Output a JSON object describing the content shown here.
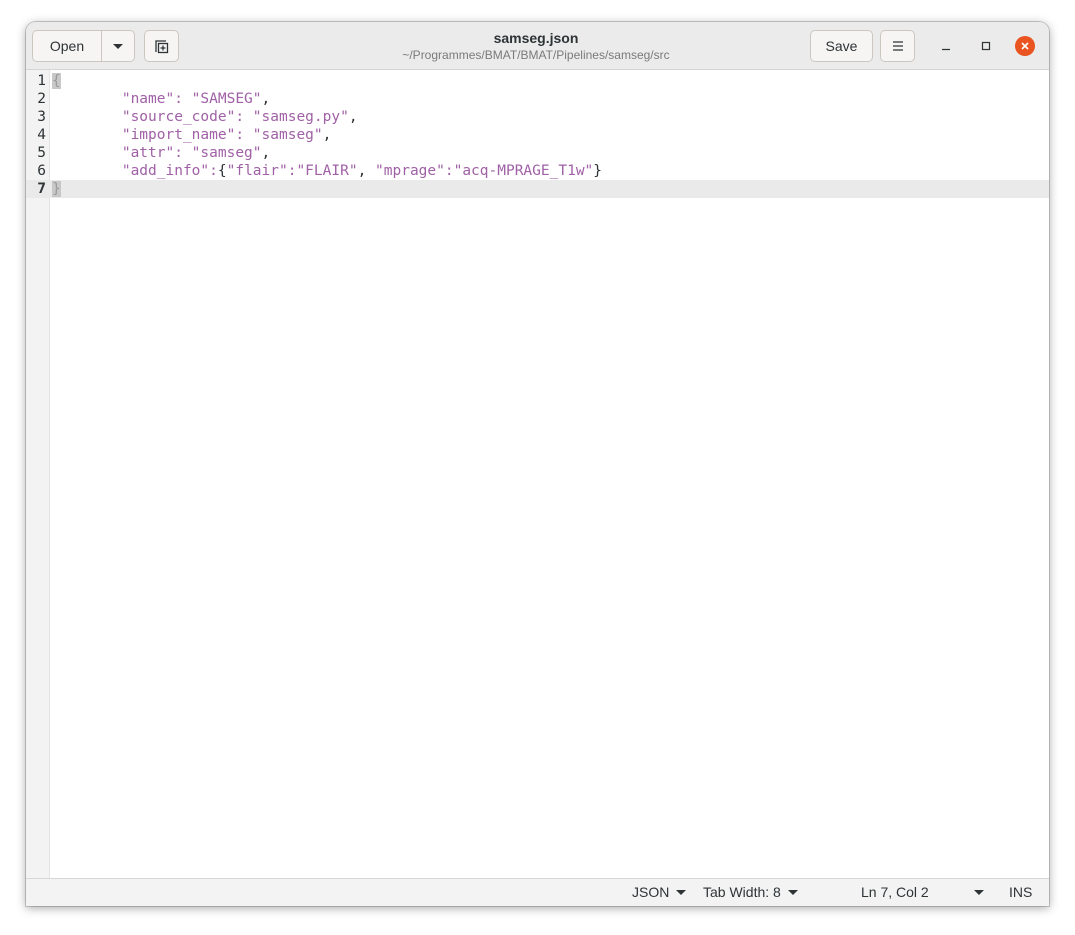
{
  "header": {
    "open_label": "Open",
    "save_label": "Save",
    "title": "samseg.json",
    "path": "~/Programmes/BMAT/BMAT/Pipelines/samseg/src"
  },
  "editor": {
    "lines": [
      {
        "num": "1",
        "parts": [
          {
            "t": "{",
            "c": "brace-hl"
          }
        ]
      },
      {
        "num": "2",
        "parts": [
          {
            "t": "        ",
            "c": ""
          },
          {
            "t": "\"name\": \"SAMSEG\"",
            "c": "str"
          },
          {
            "t": ",",
            "c": ""
          }
        ]
      },
      {
        "num": "3",
        "parts": [
          {
            "t": "        ",
            "c": ""
          },
          {
            "t": "\"source_code\": \"samseg.py\"",
            "c": "str"
          },
          {
            "t": ",",
            "c": ""
          }
        ]
      },
      {
        "num": "4",
        "parts": [
          {
            "t": "        ",
            "c": ""
          },
          {
            "t": "\"import_name\": \"samseg\"",
            "c": "str"
          },
          {
            "t": ",",
            "c": ""
          }
        ]
      },
      {
        "num": "5",
        "parts": [
          {
            "t": "        ",
            "c": ""
          },
          {
            "t": "\"attr\": \"samseg\"",
            "c": "str"
          },
          {
            "t": ",",
            "c": ""
          }
        ]
      },
      {
        "num": "6",
        "parts": [
          {
            "t": "        ",
            "c": ""
          },
          {
            "t": "\"add_info\":",
            "c": "str"
          },
          {
            "t": "{",
            "c": ""
          },
          {
            "t": "\"flair\":\"FLAIR\"",
            "c": "str"
          },
          {
            "t": ", ",
            "c": ""
          },
          {
            "t": "\"mprage\":\"acq-MPRAGE_T1w\"",
            "c": "str"
          },
          {
            "t": "}",
            "c": ""
          }
        ]
      },
      {
        "num": "7",
        "parts": [
          {
            "t": "}",
            "c": "brace-hl"
          }
        ],
        "current": true
      }
    ]
  },
  "statusbar": {
    "language": "JSON",
    "tab_width": "Tab Width: 8",
    "position": "Ln 7, Col 2",
    "mode": "INS"
  },
  "colors": {
    "accent_close": "#e95420",
    "string": "#a061a6"
  }
}
